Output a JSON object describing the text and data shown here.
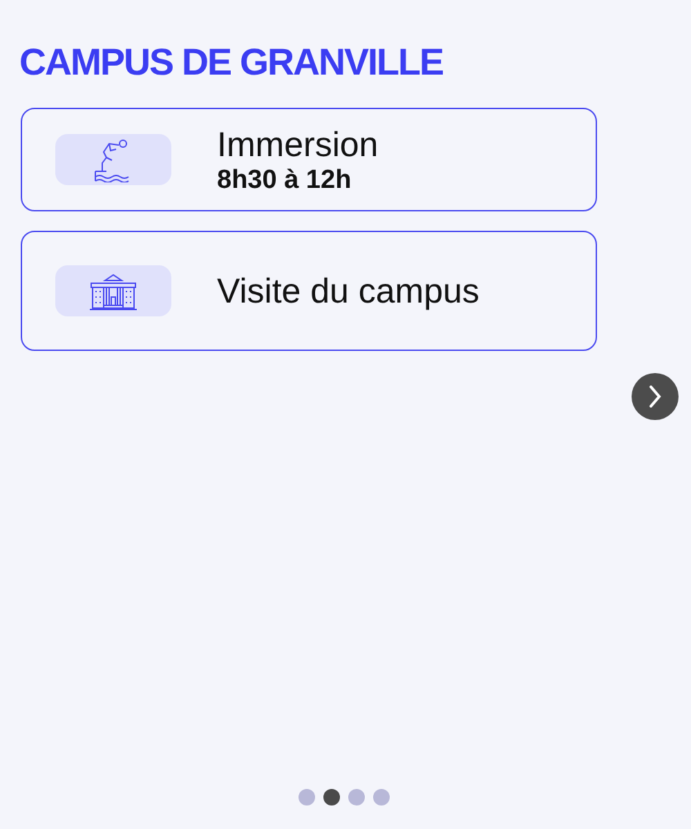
{
  "title": "CAMPUS DE GRANVILLE",
  "items": [
    {
      "kind": "diver",
      "label": "Immersion",
      "detail": "8h30 à 12h"
    },
    {
      "kind": "building",
      "label": "Visite du campus"
    }
  ],
  "pagination": [
    {
      "selected": false
    },
    {
      "selected": true
    },
    {
      "selected": false
    },
    {
      "selected": false
    }
  ]
}
